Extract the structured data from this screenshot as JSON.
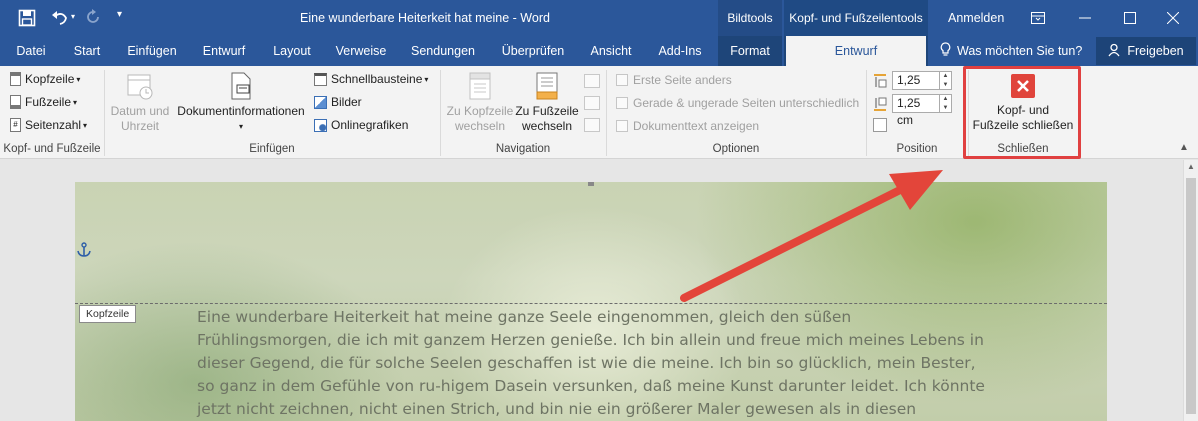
{
  "titlebar": {
    "title": "Eine wunderbare Heiterkeit hat meine - Word",
    "context_groups": [
      "Bildtools",
      "Kopf- und Fußzeilentools"
    ],
    "signin": "Anmelden"
  },
  "tabs": [
    "Datei",
    "Start",
    "Einfügen",
    "Entwurf",
    "Layout",
    "Verweise",
    "Sendungen",
    "Überprüfen",
    "Ansicht",
    "Add-Ins",
    "Format",
    "Entwurf"
  ],
  "tell_me": "Was möchten Sie tun?",
  "share": "Freigeben",
  "ribbon": {
    "group1": {
      "items": [
        "Kopfzeile",
        "Fußzeile",
        "Seitenzahl"
      ],
      "label": "Kopf- und Fußzeile"
    },
    "group2": {
      "datum_line1": "Datum und",
      "datum_line2": "Uhrzeit",
      "dokinfo": "Dokumentinformationen",
      "schnell": "Schnellbausteine",
      "bilder": "Bilder",
      "online": "Onlinegrafiken",
      "label": "Einfügen"
    },
    "group3": {
      "kopf_line1": "Zu Kopfzeile",
      "kopf_line2": "wechseln",
      "fuss_line1": "Zu Fußzeile",
      "fuss_line2": "wechseln",
      "label": "Navigation"
    },
    "group4": {
      "options": [
        "Erste Seite anders",
        "Gerade & ungerade Seiten unterschiedlich",
        "Dokumenttext anzeigen"
      ],
      "label": "Optionen"
    },
    "group5": {
      "top_value": "1,25 cm",
      "bottom_value": "1,25 cm",
      "label": "Position"
    },
    "group6": {
      "close_line1": "Kopf- und",
      "close_line2": "Fußzeile schließen",
      "label": "Schließen"
    }
  },
  "document": {
    "header_tag": "Kopfzeile",
    "lines": [
      "Eine wunderbare Heiterkeit hat meine ganze Seele eingenommen, gleich den süßen",
      "Frühlingsmorgen, die ich mit ganzem Herzen genieße. Ich bin allein und freue mich meines Lebens in",
      "dieser Gegend, die für solche Seelen geschaffen ist wie die meine. Ich bin so glücklich, mein Bester,",
      "so ganz in dem Gefühle von ru-higem Dasein versunken, daß meine Kunst darunter leidet. Ich könnte",
      "jetzt nicht zeichnen, nicht einen Strich, und bin nie ein größerer Maler gewesen als in diesen"
    ]
  },
  "colors": {
    "word_blue": "#2b579a",
    "close_red": "#e0443b",
    "highlight_red": "#e04040",
    "arrow_red": "#e3453a"
  }
}
